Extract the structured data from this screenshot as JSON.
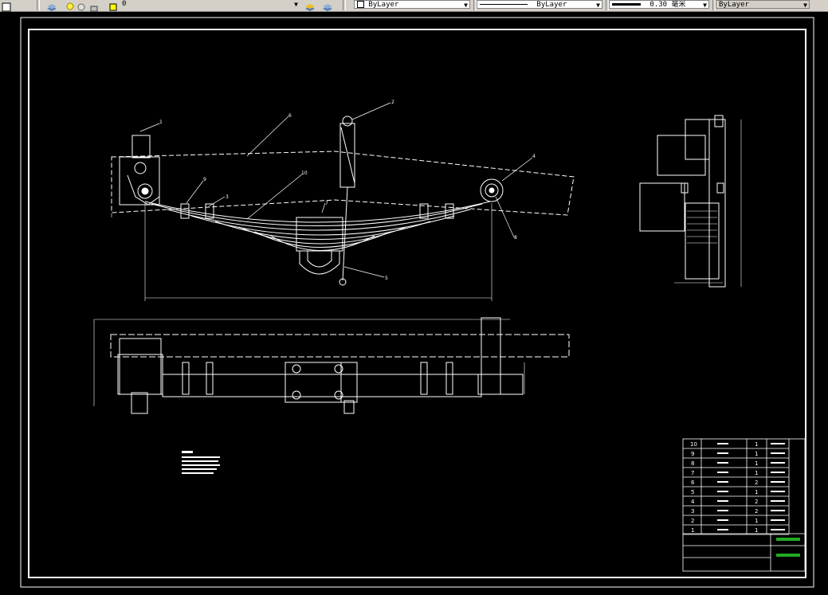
{
  "toolbar": {
    "layer_value": "0",
    "color_value": "ByLayer",
    "linetype_value": "ByLayer",
    "lineweight_value": "0.30 毫米",
    "plotstyle_value": "ByLayer"
  },
  "drawing": {
    "balloons": [
      "1",
      "2",
      "3",
      "4",
      "5",
      "6",
      "7",
      "8",
      "9",
      "10"
    ],
    "dim_small": [
      "■■",
      "■■",
      "■■■■"
    ]
  },
  "bom": {
    "rows": [
      {
        "no": "10",
        "qty": "1"
      },
      {
        "no": "9",
        "qty": "1"
      },
      {
        "no": "8",
        "qty": "1"
      },
      {
        "no": "7",
        "qty": "1"
      },
      {
        "no": "6",
        "qty": "2"
      },
      {
        "no": "5",
        "qty": "1"
      },
      {
        "no": "4",
        "qty": "2"
      },
      {
        "no": "3",
        "qty": "2"
      },
      {
        "no": "2",
        "qty": "1"
      },
      {
        "no": "1",
        "qty": "1"
      }
    ]
  },
  "colors": {
    "background": "#000000",
    "lines": "#ffffff",
    "title_green": "#22aa22",
    "toolbar": "#d4d0c8"
  }
}
